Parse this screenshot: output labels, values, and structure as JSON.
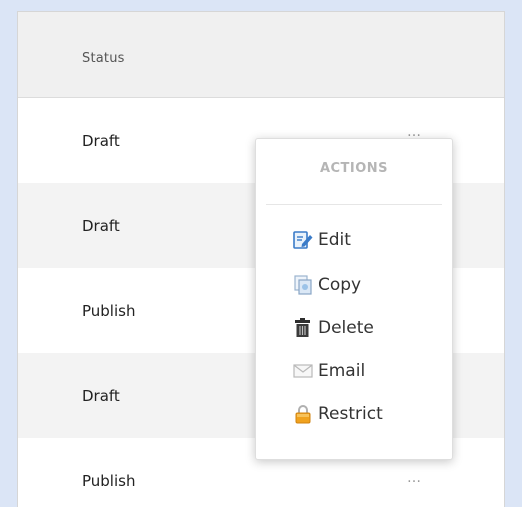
{
  "table": {
    "header": "Status",
    "rows": [
      {
        "status": "Draft",
        "more": "…",
        "shade": "plain"
      },
      {
        "status": "Draft",
        "more": "",
        "shade": "alt"
      },
      {
        "status": "Publish",
        "more": "",
        "shade": "plain"
      },
      {
        "status": "Draft",
        "more": "",
        "shade": "alt"
      },
      {
        "status": "Publish",
        "more": "…",
        "shade": "plain"
      }
    ]
  },
  "actions_menu": {
    "title": "ACTIONS",
    "items": [
      {
        "label": "Edit",
        "icon": "edit-icon"
      },
      {
        "label": "Copy",
        "icon": "copy-icon"
      },
      {
        "label": "Delete",
        "icon": "trash-icon"
      },
      {
        "label": "Email",
        "icon": "envelope-icon"
      },
      {
        "label": "Restrict",
        "icon": "lock-icon"
      }
    ]
  },
  "colors": {
    "page_background": "#dbe5f6",
    "header_background": "#f0f0f0",
    "alt_row": "#f3f3f3",
    "menu_title": "#b5b5b5"
  }
}
